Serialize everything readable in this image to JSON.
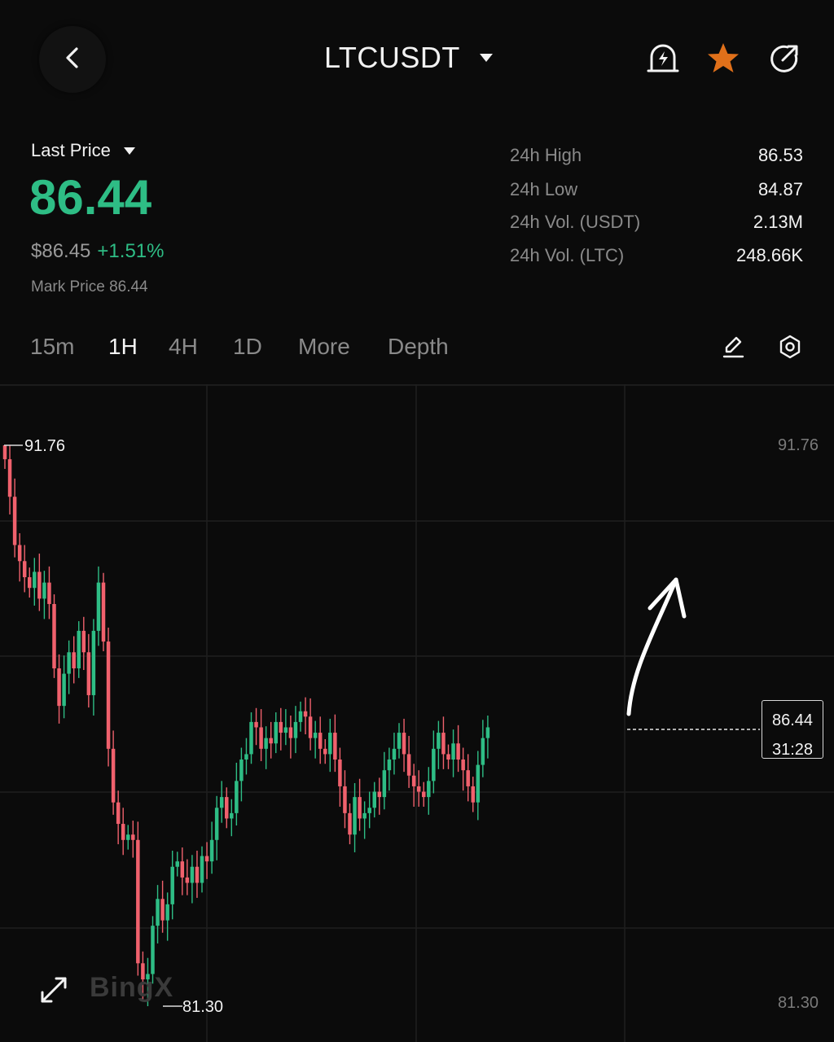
{
  "header": {
    "back_icon": "chevron-left-icon",
    "pair": "LTCUSDT",
    "icons": [
      "alert-bell-icon",
      "star-icon",
      "share-icon"
    ],
    "star_color": "#e0701a"
  },
  "price": {
    "label": "Last Price",
    "value": "86.44",
    "usd": "$86.45",
    "change": "+1.51%",
    "mark": "Mark Price 86.44",
    "up_color": "#2ebd85",
    "down_color": "#f0616d"
  },
  "stats": [
    {
      "label": "24h High",
      "value": "86.53"
    },
    {
      "label": "24h Low",
      "value": "84.87"
    },
    {
      "label": "24h Vol. (USDT)",
      "value": "2.13M"
    },
    {
      "label": "24h Vol. (LTC)",
      "value": "248.66K"
    }
  ],
  "tabs": [
    {
      "label": "15m",
      "active": false
    },
    {
      "label": "1H",
      "active": true
    },
    {
      "label": "4H",
      "active": false
    },
    {
      "label": "1D",
      "active": false
    },
    {
      "label": "More",
      "active": false
    },
    {
      "label": "Depth",
      "active": false
    }
  ],
  "tools": [
    "edit-pencil-icon",
    "settings-hex-icon"
  ],
  "chart": {
    "max_label": "91.76",
    "min_label": "81.30",
    "axis_top": "91.76",
    "axis_bottom": "81.30",
    "current_price": "86.44",
    "countdown": "31:28",
    "watermark": "BingX"
  },
  "chart_data": {
    "type": "candlestick",
    "interval": "1H",
    "ylim": [
      81.3,
      91.76
    ],
    "grid": true,
    "annotation": "hand-drawn upward arrow",
    "close": [
      91.5,
      90.8,
      89.9,
      89.6,
      89.3,
      89.1,
      89.4,
      88.9,
      89.2,
      88.8,
      87.6,
      86.9,
      87.5,
      87.9,
      87.6,
      88.3,
      87.9,
      87.1,
      88.3,
      89.2,
      88.1,
      86.1,
      85.1,
      84.7,
      84.4,
      84.5,
      84.4,
      82.1,
      81.8,
      81.9,
      82.8,
      83.3,
      82.9,
      83.2,
      83.9,
      84.0,
      83.7,
      83.6,
      83.9,
      83.6,
      84.1,
      84.0,
      84.4,
      85.0,
      85.2,
      84.8,
      84.9,
      85.5,
      85.9,
      86.0,
      86.6,
      86.5,
      86.1,
      86.3,
      86.2,
      86.6,
      86.4,
      86.5,
      86.3,
      86.6,
      86.8,
      86.7,
      86.3,
      86.4,
      86.1,
      86.0,
      86.4,
      85.9,
      85.4,
      84.9,
      84.5,
      85.2,
      84.8,
      84.9,
      85.0,
      85.3,
      85.2,
      85.7,
      85.9,
      86.1,
      86.4,
      86.0,
      85.6,
      85.4,
      85.3,
      85.2,
      85.5,
      86.1,
      86.4,
      86.0,
      85.9,
      86.2,
      85.9,
      85.7,
      85.4,
      85.1,
      85.8,
      86.3,
      86.5
    ]
  }
}
